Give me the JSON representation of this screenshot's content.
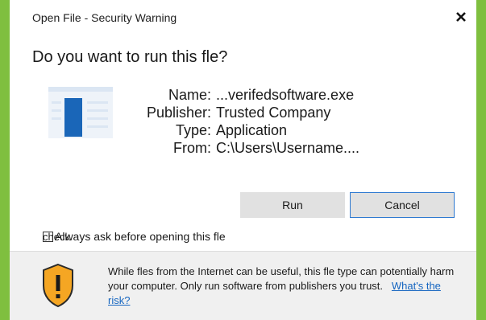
{
  "window": {
    "title": "Open File - Security Warning",
    "close_icon": "close-icon"
  },
  "question": "Do you want to run this fle?",
  "file_info": {
    "name_label": "Name:",
    "name_value": "...verifedsoftware.exe",
    "publisher_label": "Publisher:",
    "publisher_value": "Trusted Company",
    "type_label": "Type:",
    "type_value": "Application",
    "from_label": "From:",
    "from_value": "C:\\Users\\Username...."
  },
  "buttons": {
    "run": "Run",
    "cancel": "Cancel"
  },
  "checkbox": {
    "overlay_text": "check",
    "label": "Always ask before opening this fle"
  },
  "warning": {
    "text": "While fles from the Internet can be useful, this fle type can potentially harm your computer. Only run software from publishers you trust.",
    "link": "What's the risk?"
  },
  "colors": {
    "background": "#7fbf3f",
    "accent_blue": "#1a66b8",
    "shield_orange": "#f5a623",
    "link": "#1565c0"
  }
}
